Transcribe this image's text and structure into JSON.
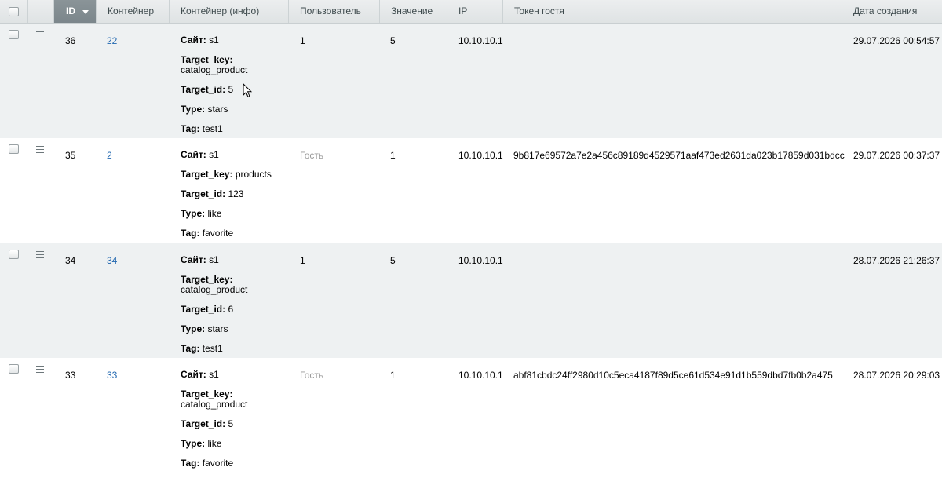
{
  "header": {
    "id": "ID",
    "container": "Контейнер",
    "container_info": "Контейнер (инфо)",
    "user": "Пользователь",
    "value": "Значение",
    "ip": "IP",
    "guest_token": "Токен гостя",
    "created": "Дата создания"
  },
  "rows": [
    {
      "id": "36",
      "container": "22",
      "info": {
        "site_label": "Сайт:",
        "site": "s1",
        "key_label": "Target_key:",
        "key": "catalog_product",
        "tid_label": "Target_id:",
        "tid": "5",
        "type_label": "Type:",
        "type": "stars",
        "tag_label": "Tag:",
        "tag": "test1"
      },
      "user": "1",
      "value": "5",
      "ip": "10.10.10.1",
      "token": "",
      "created": "29.07.2026 00:54:57"
    },
    {
      "id": "35",
      "container": "2",
      "info": {
        "site_label": "Сайт:",
        "site": "s1",
        "key_label": "Target_key:",
        "key": "products",
        "tid_label": "Target_id:",
        "tid": "123",
        "type_label": "Type:",
        "type": "like",
        "tag_label": "Tag:",
        "tag": "favorite"
      },
      "user": "Гость",
      "value": "1",
      "ip": "10.10.10.1",
      "token": "9b817e69572a7e2a456c89189d4529571aaf473ed2631da023b17859d031bdcc",
      "created": "29.07.2026 00:37:37"
    },
    {
      "id": "34",
      "container": "34",
      "info": {
        "site_label": "Сайт:",
        "site": "s1",
        "key_label": "Target_key:",
        "key": "catalog_product",
        "tid_label": "Target_id:",
        "tid": "6",
        "type_label": "Type:",
        "type": "stars",
        "tag_label": "Tag:",
        "tag": "test1"
      },
      "user": "1",
      "value": "5",
      "ip": "10.10.10.1",
      "token": "",
      "created": "28.07.2026 21:26:37"
    },
    {
      "id": "33",
      "container": "33",
      "info": {
        "site_label": "Сайт:",
        "site": "s1",
        "key_label": "Target_key:",
        "key": "catalog_product",
        "tid_label": "Target_id:",
        "tid": "5",
        "type_label": "Type:",
        "type": "like",
        "tag_label": "Tag:",
        "tag": "favorite"
      },
      "user": "Гость",
      "value": "1",
      "ip": "10.10.10.1",
      "token": "abf81cbdc24ff2980d10c5eca4187f89d5ce61d534e91d1b559dbd7fb0b2a475",
      "created": "28.07.2026 20:29:03"
    }
  ],
  "colors": {
    "row_shade": "#eef1f2",
    "link": "#2067b0",
    "muted": "#9a9a9a",
    "sorted_header": "#7b868b"
  },
  "icons": {
    "row_menu": "menu-icon",
    "sort": "sort-desc-icon",
    "pointer": "mouse-cursor-icon"
  }
}
